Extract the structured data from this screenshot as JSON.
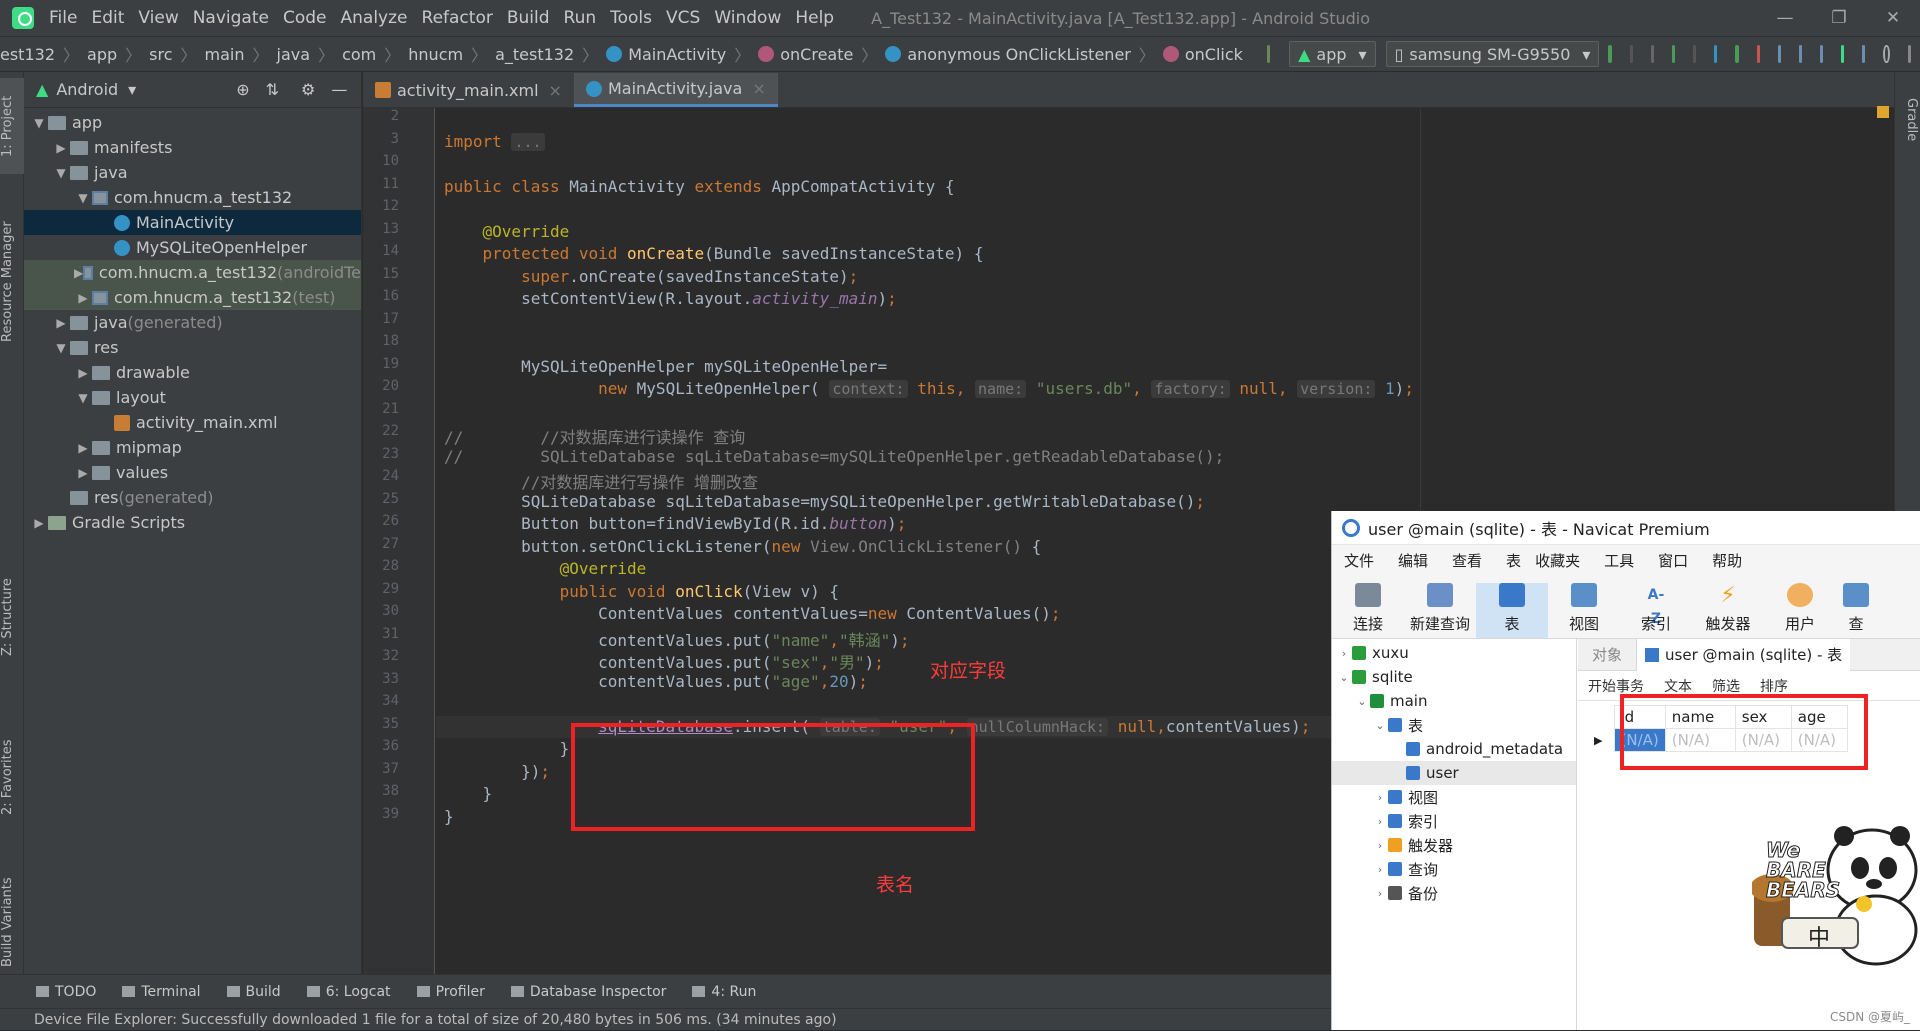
{
  "menubar": {
    "items": [
      "File",
      "Edit",
      "View",
      "Navigate",
      "Code",
      "Analyze",
      "Refactor",
      "Build",
      "Run",
      "Tools",
      "VCS",
      "Window",
      "Help"
    ],
    "title": "A_Test132 - MainActivity.java [A_Test132.app] - Android Studio"
  },
  "navbar": {
    "crumbs": [
      "est132",
      "app",
      "src",
      "main",
      "java",
      "com",
      "hnucm",
      "a_test132",
      "MainActivity",
      "onCreate",
      "anonymous OnClickListener",
      "onClick"
    ],
    "run_config": "app",
    "device": "samsung SM-G9550"
  },
  "left_strip": {
    "project": "1: Project",
    "resource": "Resource Manager",
    "structure": "Z: Structure",
    "favorites": "2: Favorites",
    "build_variants": "Build Variants"
  },
  "right_strip": {
    "gradle": "Gradle"
  },
  "project": {
    "view": "Android",
    "tree": [
      {
        "label": "app",
        "level": 0,
        "arrow": "▼",
        "icon": "folder"
      },
      {
        "label": "manifests",
        "level": 1,
        "arrow": "▶",
        "icon": "folder"
      },
      {
        "label": "java",
        "level": 1,
        "arrow": "▼",
        "icon": "folder"
      },
      {
        "label": "com.hnucm.a_test132",
        "level": 2,
        "arrow": "▼",
        "icon": "pkg"
      },
      {
        "label": "MainActivity",
        "level": 3,
        "arrow": "",
        "icon": "class",
        "selected": true
      },
      {
        "label": "MySQLiteOpenHelper",
        "level": 3,
        "arrow": "",
        "icon": "class"
      },
      {
        "label": "com.hnucm.a_test132",
        "suffix": " (androidTe",
        "level": 2,
        "arrow": "▶",
        "icon": "pkg",
        "test": true
      },
      {
        "label": "com.hnucm.a_test132",
        "suffix": " (test)",
        "level": 2,
        "arrow": "▶",
        "icon": "pkg",
        "test": true
      },
      {
        "label": "java",
        "suffix": " (generated)",
        "level": 1,
        "arrow": "▶",
        "icon": "folder"
      },
      {
        "label": "res",
        "level": 1,
        "arrow": "▼",
        "icon": "folder"
      },
      {
        "label": "drawable",
        "level": 2,
        "arrow": "▶",
        "icon": "folder"
      },
      {
        "label": "layout",
        "level": 2,
        "arrow": "▼",
        "icon": "folder"
      },
      {
        "label": "activity_main.xml",
        "level": 3,
        "arrow": "",
        "icon": "xml"
      },
      {
        "label": "mipmap",
        "level": 2,
        "arrow": "▶",
        "icon": "folder"
      },
      {
        "label": "values",
        "level": 2,
        "arrow": "▶",
        "icon": "folder"
      },
      {
        "label": "res",
        "suffix": " (generated)",
        "level": 1,
        "arrow": "",
        "icon": "folder"
      },
      {
        "label": "Gradle Scripts",
        "level": 0,
        "arrow": "▶",
        "icon": "gradle"
      }
    ]
  },
  "editor": {
    "tabs": [
      {
        "label": "activity_main.xml",
        "active": false
      },
      {
        "label": "MainActivity.java",
        "active": true
      }
    ],
    "line_numbers": [
      "2",
      "3",
      "10",
      "11",
      "12",
      "13",
      "14",
      "15",
      "16",
      "17",
      "18",
      "19",
      "20",
      "21",
      "22",
      "23",
      "24",
      "25",
      "26",
      "27",
      "28",
      "29",
      "30",
      "31",
      "32",
      "33",
      "34",
      "35",
      "36",
      "37",
      "38",
      "39"
    ],
    "code_lines": [
      "",
      "<span class='kw'>import</span> <span class='hint'>...</span>",
      "",
      "<span class='kw'>public class</span> MainActivity <span class='kw'>extends</span> AppCompatActivity {",
      "",
      "    <span class='an'>@Override</span>",
      "    <span class='kw'>protected void</span> <span class='fn'>onCreate</span>(Bundle savedInstanceState) {",
      "        <span class='kw'>super</span>.onCreate(savedInstanceState)<span class='kw'>;</span>",
      "        setContentView(R.layout.<span class='it'>activity_main</span>)<span class='kw'>;</span>",
      "",
      "",
      "        MySQLiteOpenHelper mySQLiteOpenHelper=",
      "                <span class='kw'>new</span> MySQLiteOpenHelper( <span class='hint'>context:</span> <span class='kw'>this,</span> <span class='hint'>name:</span> <span class='st'>\"users.db\"</span><span class='kw'>,</span> <span class='hint'>factory:</span> <span class='kw'>null,</span> <span class='hint'>version:</span> <span class='nm'>1</span>)<span class='kw'>;</span>",
      "",
      "<span class='cm'>//        //对数据库进行读操作 查询</span>",
      "<span class='cm'>//        SQLiteDatabase sqLiteDatabase=mySQLiteOpenHelper.getReadableDatabase();</span>",
      "        <span class='cm'>//对数据库进行写操作 增删改查</span>",
      "        SQLiteDatabase sqLiteDatabase=mySQLiteOpenHelper.getWritableDatabase()<span class='kw'>;</span>",
      "        Button button=findViewById(R.id.<span class='it'>button</span>)<span class='kw'>;</span>",
      "        button.setOnClickListener(<span class='kw'>new</span> <span class='cm'>View.OnClickListener()</span> {",
      "            <span class='an'>@Override</span>",
      "            <span class='kw'>public void</span> <span class='fn'>onClick</span>(View v) {",
      "                ContentValues contentValues=<span class='kw'>new</span> ContentValues()<span class='kw'>;</span>",
      "                contentValues.put(<span class='st'>\"name\"</span><span class='kw'>,</span><span class='st'>\"韩涵\"</span>)<span class='kw'>;</span>",
      "                contentValues.put(<span class='st'>\"sex\"</span><span class='kw'>,</span><span class='st'>\"男\"</span>)<span class='kw'>;</span>",
      "                contentValues.put(<span class='st'>\"age\"</span><span class='kw'>,</span><span class='nm'>20</span>)<span class='kw'>;</span>",
      "",
      "                <span style='color:#b389c5;text-decoration:underline'>sqLiteDatabase</span>.insert( <span class='hint'>table:</span> <span class='st'>\"user\"</span><span class='kw'>,</span> <span class='hint'>nullColumnHack:</span> <span class='kw'>null,</span>contentValues)<span class='kw'>;</span>",
      "            }",
      "        })<span class='kw'>;</span>",
      "    }",
      "}"
    ]
  },
  "annotations": {
    "fields": "对应字段",
    "table": "表名"
  },
  "bottom_tools": [
    "TODO",
    "Terminal",
    "Build",
    "6: Logcat",
    "Profiler",
    "Database Inspector",
    "4: Run"
  ],
  "status": "Device File Explorer: Successfully downloaded 1 file for a total of size of 20,480 bytes in 506 ms. (34 minutes ago)",
  "navicat": {
    "title": "user @main (sqlite) - 表 - Navicat Premium",
    "menu": [
      "文件",
      "编辑",
      "查看",
      "表",
      "收藏夹",
      "工具",
      "窗口",
      "帮助"
    ],
    "toolbar": [
      "连接",
      "新建查询",
      "表",
      "视图",
      "索引",
      "触发器",
      "用户",
      "查"
    ],
    "tree": [
      {
        "label": "xuxu",
        "level": 0,
        "arrow": "›",
        "color": "#2a9d3a"
      },
      {
        "label": "sqlite",
        "level": 0,
        "arrow": "⌄",
        "color": "#2a9d3a"
      },
      {
        "label": "main",
        "level": 1,
        "arrow": "⌄",
        "color": "#1f8f3a"
      },
      {
        "label": "表",
        "level": 2,
        "arrow": "⌄",
        "color": "#3a78c9"
      },
      {
        "label": "android_metadata",
        "level": 3,
        "arrow": "",
        "color": "#3a78c9"
      },
      {
        "label": "user",
        "level": 3,
        "arrow": "",
        "color": "#3a78c9",
        "selected": true
      },
      {
        "label": "视图",
        "level": 2,
        "arrow": "›",
        "color": "#3a78c9"
      },
      {
        "label": "索引",
        "level": 2,
        "arrow": "›",
        "color": "#3a78c9"
      },
      {
        "label": "触发器",
        "level": 2,
        "arrow": "›",
        "color": "#f0a020"
      },
      {
        "label": "查询",
        "level": 2,
        "arrow": "›",
        "color": "#3a78c9"
      },
      {
        "label": "备份",
        "level": 2,
        "arrow": "›",
        "color": "#555"
      }
    ],
    "tabs": [
      "对象",
      "user @main (sqlite) - 表"
    ],
    "subbar": [
      "开始事务",
      "文本",
      "筛选",
      "排序"
    ],
    "columns": [
      "id",
      "name",
      "sex",
      "age"
    ],
    "row": [
      "(N/A)",
      "(N/A)",
      "(N/A)",
      "(N/A)"
    ]
  },
  "watermark": "CSDN @夏屿_",
  "sticker": {
    "text": "We BARE BEARS",
    "sub": "中"
  },
  "colors": {
    "accent": "#4a88c7",
    "red_box": "#ee2222",
    "annotation": "#ff3b3b"
  }
}
